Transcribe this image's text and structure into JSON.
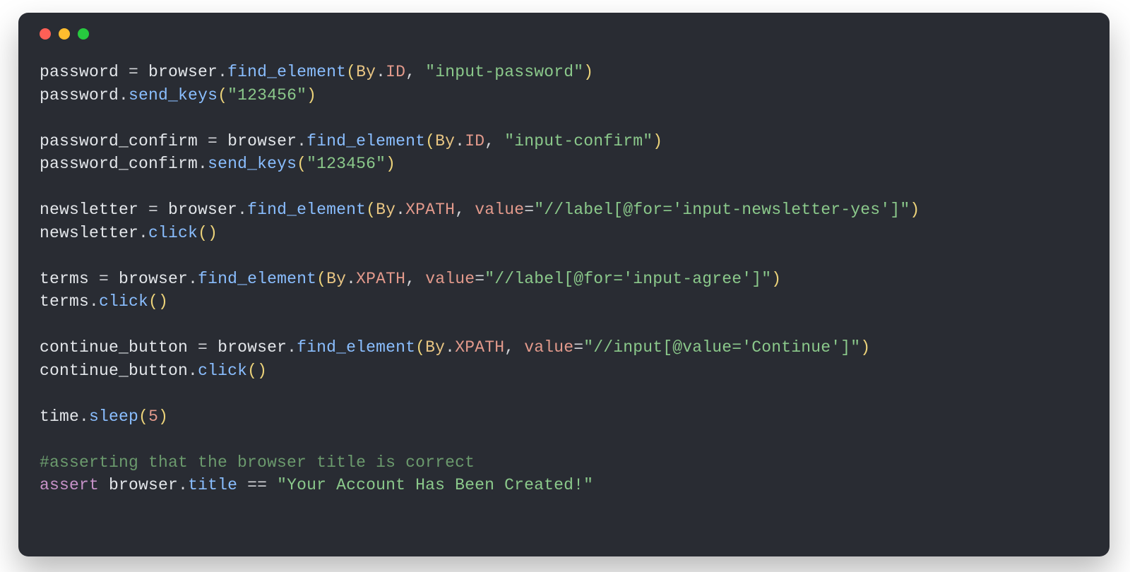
{
  "window": {
    "traffic": {
      "red": "#ff5f56",
      "yellow": "#ffbd2e",
      "green": "#27c93f"
    }
  },
  "code": {
    "lines": [
      {
        "tokens": [
          {
            "t": "password",
            "c": "obj"
          },
          {
            "t": " = ",
            "c": "op"
          },
          {
            "t": "browser",
            "c": "obj"
          },
          {
            "t": ".",
            "c": "op"
          },
          {
            "t": "find_element",
            "c": "method"
          },
          {
            "t": "(",
            "c": "paren"
          },
          {
            "t": "By",
            "c": "class"
          },
          {
            "t": ".",
            "c": "op"
          },
          {
            "t": "ID",
            "c": "attr"
          },
          {
            "t": ", ",
            "c": "op"
          },
          {
            "t": "\"input-password\"",
            "c": "str"
          },
          {
            "t": ")",
            "c": "paren"
          }
        ]
      },
      {
        "tokens": [
          {
            "t": "password",
            "c": "obj"
          },
          {
            "t": ".",
            "c": "op"
          },
          {
            "t": "send_keys",
            "c": "method"
          },
          {
            "t": "(",
            "c": "paren"
          },
          {
            "t": "\"123456\"",
            "c": "str"
          },
          {
            "t": ")",
            "c": "paren"
          }
        ]
      },
      {
        "tokens": []
      },
      {
        "tokens": [
          {
            "t": "password_confirm",
            "c": "obj"
          },
          {
            "t": " = ",
            "c": "op"
          },
          {
            "t": "browser",
            "c": "obj"
          },
          {
            "t": ".",
            "c": "op"
          },
          {
            "t": "find_element",
            "c": "method"
          },
          {
            "t": "(",
            "c": "paren"
          },
          {
            "t": "By",
            "c": "class"
          },
          {
            "t": ".",
            "c": "op"
          },
          {
            "t": "ID",
            "c": "attr"
          },
          {
            "t": ", ",
            "c": "op"
          },
          {
            "t": "\"input-confirm\"",
            "c": "str"
          },
          {
            "t": ")",
            "c": "paren"
          }
        ]
      },
      {
        "tokens": [
          {
            "t": "password_confirm",
            "c": "obj"
          },
          {
            "t": ".",
            "c": "op"
          },
          {
            "t": "send_keys",
            "c": "method"
          },
          {
            "t": "(",
            "c": "paren"
          },
          {
            "t": "\"123456\"",
            "c": "str"
          },
          {
            "t": ")",
            "c": "paren"
          }
        ]
      },
      {
        "tokens": []
      },
      {
        "tokens": [
          {
            "t": "newsletter",
            "c": "obj"
          },
          {
            "t": " = ",
            "c": "op"
          },
          {
            "t": "browser",
            "c": "obj"
          },
          {
            "t": ".",
            "c": "op"
          },
          {
            "t": "find_element",
            "c": "method"
          },
          {
            "t": "(",
            "c": "paren"
          },
          {
            "t": "By",
            "c": "class"
          },
          {
            "t": ".",
            "c": "op"
          },
          {
            "t": "XPATH",
            "c": "attr"
          },
          {
            "t": ", ",
            "c": "op"
          },
          {
            "t": "value",
            "c": "kwarg"
          },
          {
            "t": "=",
            "c": "op"
          },
          {
            "t": "\"//label[@for='input-newsletter-yes']\"",
            "c": "xpath"
          },
          {
            "t": ")",
            "c": "paren"
          }
        ]
      },
      {
        "tokens": [
          {
            "t": "newsletter",
            "c": "obj"
          },
          {
            "t": ".",
            "c": "op"
          },
          {
            "t": "click",
            "c": "method"
          },
          {
            "t": "(",
            "c": "paren"
          },
          {
            "t": ")",
            "c": "paren"
          }
        ]
      },
      {
        "tokens": []
      },
      {
        "tokens": [
          {
            "t": "terms",
            "c": "obj"
          },
          {
            "t": " = ",
            "c": "op"
          },
          {
            "t": "browser",
            "c": "obj"
          },
          {
            "t": ".",
            "c": "op"
          },
          {
            "t": "find_element",
            "c": "method"
          },
          {
            "t": "(",
            "c": "paren"
          },
          {
            "t": "By",
            "c": "class"
          },
          {
            "t": ".",
            "c": "op"
          },
          {
            "t": "XPATH",
            "c": "attr"
          },
          {
            "t": ", ",
            "c": "op"
          },
          {
            "t": "value",
            "c": "kwarg"
          },
          {
            "t": "=",
            "c": "op"
          },
          {
            "t": "\"//label[@for='input-agree']\"",
            "c": "xpath"
          },
          {
            "t": ")",
            "c": "paren"
          }
        ]
      },
      {
        "tokens": [
          {
            "t": "terms",
            "c": "obj"
          },
          {
            "t": ".",
            "c": "op"
          },
          {
            "t": "click",
            "c": "method"
          },
          {
            "t": "(",
            "c": "paren"
          },
          {
            "t": ")",
            "c": "paren"
          }
        ]
      },
      {
        "tokens": []
      },
      {
        "tokens": [
          {
            "t": "continue_button",
            "c": "obj"
          },
          {
            "t": " = ",
            "c": "op"
          },
          {
            "t": "browser",
            "c": "obj"
          },
          {
            "t": ".",
            "c": "op"
          },
          {
            "t": "find_element",
            "c": "method"
          },
          {
            "t": "(",
            "c": "paren"
          },
          {
            "t": "By",
            "c": "class"
          },
          {
            "t": ".",
            "c": "op"
          },
          {
            "t": "XPATH",
            "c": "attr"
          },
          {
            "t": ", ",
            "c": "op"
          },
          {
            "t": "value",
            "c": "kwarg"
          },
          {
            "t": "=",
            "c": "op"
          },
          {
            "t": "\"//input[@value='Continue']\"",
            "c": "xpath"
          },
          {
            "t": ")",
            "c": "paren"
          }
        ]
      },
      {
        "tokens": [
          {
            "t": "continue_button",
            "c": "obj"
          },
          {
            "t": ".",
            "c": "op"
          },
          {
            "t": "click",
            "c": "method"
          },
          {
            "t": "(",
            "c": "paren"
          },
          {
            "t": ")",
            "c": "paren"
          }
        ]
      },
      {
        "tokens": []
      },
      {
        "tokens": [
          {
            "t": "time",
            "c": "obj"
          },
          {
            "t": ".",
            "c": "op"
          },
          {
            "t": "sleep",
            "c": "method"
          },
          {
            "t": "(",
            "c": "paren"
          },
          {
            "t": "5",
            "c": "num"
          },
          {
            "t": ")",
            "c": "paren"
          }
        ]
      },
      {
        "tokens": []
      },
      {
        "tokens": [
          {
            "t": "#asserting that the browser title is correct",
            "c": "comment"
          }
        ]
      },
      {
        "tokens": [
          {
            "t": "assert",
            "c": "kw"
          },
          {
            "t": " ",
            "c": "op"
          },
          {
            "t": "browser",
            "c": "obj"
          },
          {
            "t": ".",
            "c": "op"
          },
          {
            "t": "title",
            "c": "method"
          },
          {
            "t": " == ",
            "c": "op"
          },
          {
            "t": "\"Your Account Has Been Created!\"",
            "c": "str"
          }
        ]
      }
    ]
  }
}
